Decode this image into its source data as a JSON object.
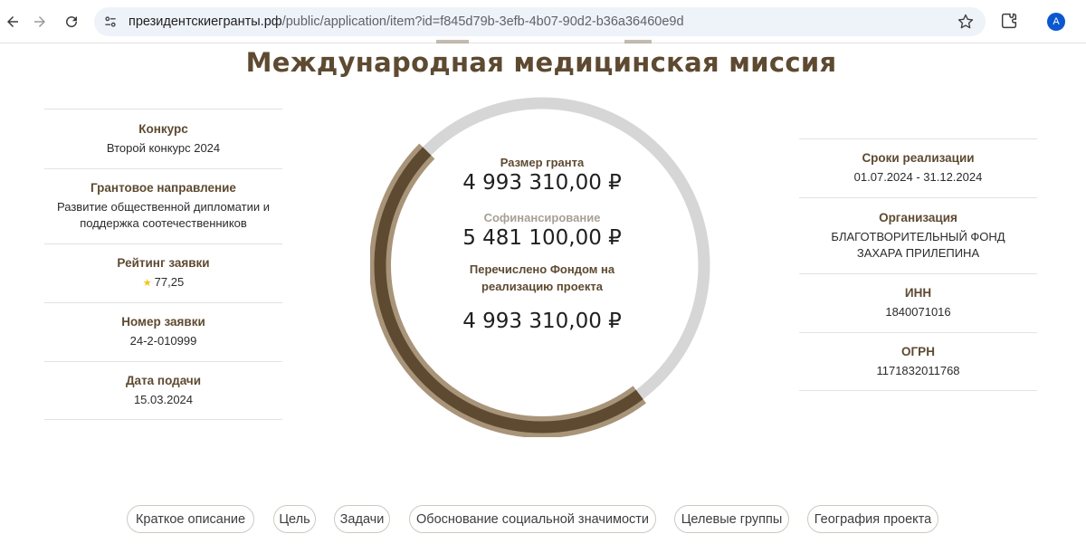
{
  "browser": {
    "url_host": "президентскиегранты.рф",
    "url_path": "/public/application/item?id=f845d79b-3efb-4b07-90d2-b36a36460e9d",
    "avatar_letter": "A",
    "accent_color": "#0b57d0"
  },
  "page": {
    "title": "Международная медицинская миссия"
  },
  "left_info": [
    {
      "label": "Конкурс",
      "value": "Второй конкурс 2024"
    },
    {
      "label": "Грантовое направление",
      "value": "Развитие общественной дипломатии и поддержка соотечественников"
    },
    {
      "label": "Рейтинг заявки",
      "value": "77,25",
      "icon": "star-icon"
    },
    {
      "label": "Номер заявки",
      "value": "24-2-010999"
    },
    {
      "label": "Дата подачи",
      "value": "15.03.2024"
    }
  ],
  "right_info": [
    {
      "label": "Сроки реализации",
      "value": "01.07.2024 - 31.12.2024"
    },
    {
      "label": "Организация",
      "value": "БЛАГОТВОРИТЕЛЬНЫЙ ФОНД ЗАХАРА ПРИЛЕПИНА"
    },
    {
      "label": "ИНН",
      "value": "1840071016"
    },
    {
      "label": "ОГРН",
      "value": "1171832011768"
    }
  ],
  "grant": {
    "size_label": "Размер гранта",
    "size_value": "4 993 310,00 ₽",
    "cofinancing_label": "Софинансирование",
    "cofinancing_value": "5 481 100,00 ₽",
    "transferred_label": "Перечислено Фондом на реализацию проекта",
    "transferred_value": "4 993 310,00 ₽",
    "grant_share_of_total": 0.477,
    "transferred_share_of_grant": 1.0,
    "colors": {
      "track": "#d6d6d6",
      "grant": "#a89478",
      "transferred": "#5e4a31"
    }
  },
  "tabs": [
    "Краткое описание",
    "Цель",
    "Задачи",
    "Обоснование социальной значимости",
    "Целевые группы",
    "География проекта"
  ]
}
